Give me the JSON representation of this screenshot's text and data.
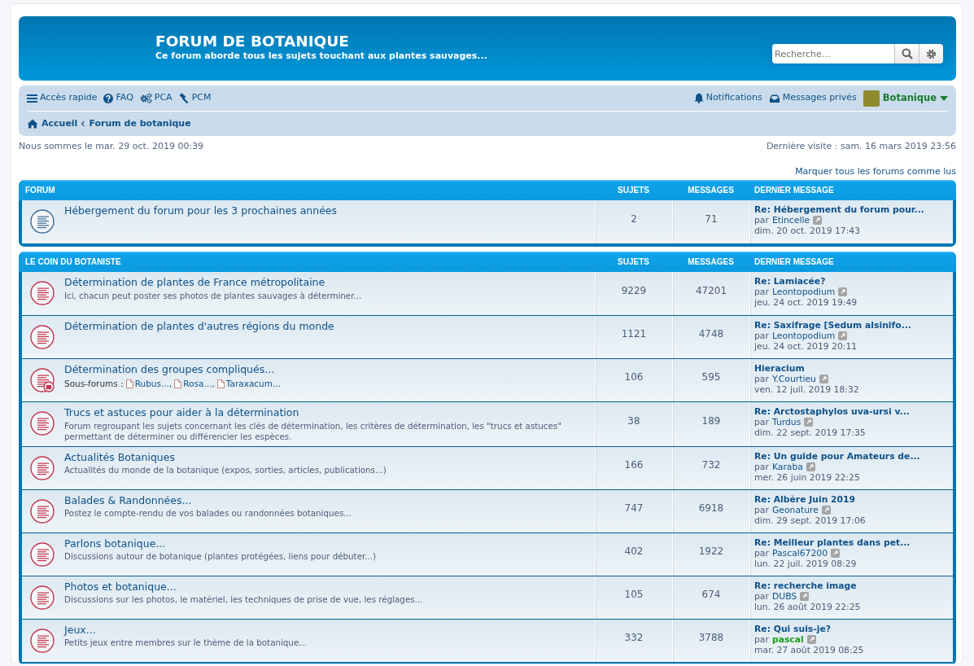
{
  "header": {
    "title": "FORUM DE BOTANIQUE",
    "description": "Ce forum aborde tous les sujets touchant aux plantes sauvages...",
    "search": {
      "placeholder": "Recherche…"
    }
  },
  "navbar": {
    "quick_links": [
      "Accès rapide",
      "FAQ",
      "PCA",
      "PCM"
    ],
    "user_links": [
      "Notifications",
      "Messages privés"
    ],
    "username": "Botanique",
    "breadcrumbs": [
      "Accueil",
      "Forum de botanique"
    ]
  },
  "current_time": "Nous sommes le mar. 29 oct. 2019 00:39",
  "last_visit": "Dernière visite : sam. 16 mars 2019 23:56",
  "mark_all_read": "Marquer tous les forums comme lus",
  "categories": [
    {
      "title": "FORUM",
      "columns": [
        "SUJETS",
        "MESSAGES",
        "DERNIER MESSAGE"
      ],
      "forums": [
        {
          "title": "Hébergement du forum pour les 3 prochaines années",
          "unread": false,
          "topics": "2",
          "posts": "71",
          "last_post": {
            "subject": "Re: Hébergement du forum pour...",
            "by": "par",
            "author": "Etincelle",
            "color": "#105289",
            "time": "dim. 20 oct. 2019 17:43"
          }
        }
      ]
    },
    {
      "title": "LE COIN DU BOTANISTE",
      "columns": [
        "SUJETS",
        "MESSAGES",
        "DERNIER MESSAGE"
      ],
      "forums": [
        {
          "title": "Détermination de plantes de France métropolitaine",
          "description": "Ici, chacun peut poster ses photos de plantes sauvages à déterminer...",
          "unread": true,
          "topics": "9229",
          "posts": "47201",
          "last_post": {
            "subject": "Re: Lamiacée?",
            "by": "par",
            "author": "Leontopodium",
            "color": "#105289",
            "time": "jeu. 24 oct. 2019 19:49"
          }
        },
        {
          "title": "Détermination de plantes d'autres régions du monde",
          "unread": true,
          "topics": "1121",
          "posts": "4748",
          "last_post": {
            "subject": "Re: Saxifrage [Sedum alsinifo...",
            "by": "par",
            "author": "Leontopodium",
            "color": "#105289",
            "time": "jeu. 24 oct. 2019 20:11"
          }
        },
        {
          "title": "Détermination des groupes compliqués...",
          "subforums_label": "Sous-forums :",
          "subforums": [
            "Rubus...,",
            "Rosa...,",
            "Taraxacum..."
          ],
          "unread": true,
          "topics": "106",
          "posts": "595",
          "last_post": {
            "subject": "Hieracium",
            "by": "par",
            "author": "Y.Courtieu",
            "color": "#105289",
            "time": "ven. 12 juil. 2019 18:32"
          }
        },
        {
          "title": "Trucs et astuces pour aider à la détermination",
          "description": "Forum regroupant les sujets concernant les clés de détermination, les critères de détermination, les \"trucs et astuces\" permettant de déterminer ou différencier les espèces.",
          "unread": true,
          "topics": "38",
          "posts": "189",
          "last_post": {
            "subject": "Re: Arctostaphylos uva-ursi v...",
            "by": "par",
            "author": "Turdus",
            "color": "#105289",
            "time": "dim. 22 sept. 2019 17:35"
          }
        },
        {
          "title": "Actualités Botaniques",
          "description": "Actualités du monde de la botanique (expos, sorties, articles, publications...)",
          "unread": true,
          "topics": "166",
          "posts": "732",
          "last_post": {
            "subject": "Re: Un guide pour Amateurs de...",
            "by": "par",
            "author": "Karaba",
            "color": "#105289",
            "time": "mer. 26 juin 2019 22:25"
          }
        },
        {
          "title": "Balades & Randonnées...",
          "description": "Postez le compte-rendu de vos balades ou randonnées botaniques...",
          "unread": true,
          "topics": "747",
          "posts": "6918",
          "last_post": {
            "subject": "Re: Albère Juin 2019",
            "by": "par",
            "author": "Geonature",
            "color": "#105289",
            "time": "dim. 29 sept. 2019 17:06"
          }
        },
        {
          "title": "Parlons botanique...",
          "description": "Discussions autour de botanique (plantes protégées, liens pour débuter...)",
          "unread": true,
          "topics": "402",
          "posts": "1922",
          "last_post": {
            "subject": "Re: Meilleur plantes dans pet...",
            "by": "par",
            "author": "Pascal67200",
            "color": "#105289",
            "time": "lun. 22 juil. 2019 08:29"
          }
        },
        {
          "title": "Photos et botanique...",
          "description": "Discussions sur les photos, le matériel, les techniques de prise de vue, les réglages...",
          "unread": true,
          "topics": "105",
          "posts": "674",
          "last_post": {
            "subject": "Re: recherche image",
            "by": "par",
            "author": "DUBS",
            "color": "#105289",
            "time": "lun. 26 août 2019 22:25"
          }
        },
        {
          "title": "Jeux...",
          "description": "Petits jeux entre membres sur le thème de la botanique...",
          "unread": true,
          "topics": "332",
          "posts": "3788",
          "last_post": {
            "subject": "Re: Qui suis-je?",
            "by": "par",
            "author": "pascal",
            "color": "#1a9e1a",
            "time": "mar. 27 août 2019 08:25"
          }
        }
      ]
    }
  ]
}
